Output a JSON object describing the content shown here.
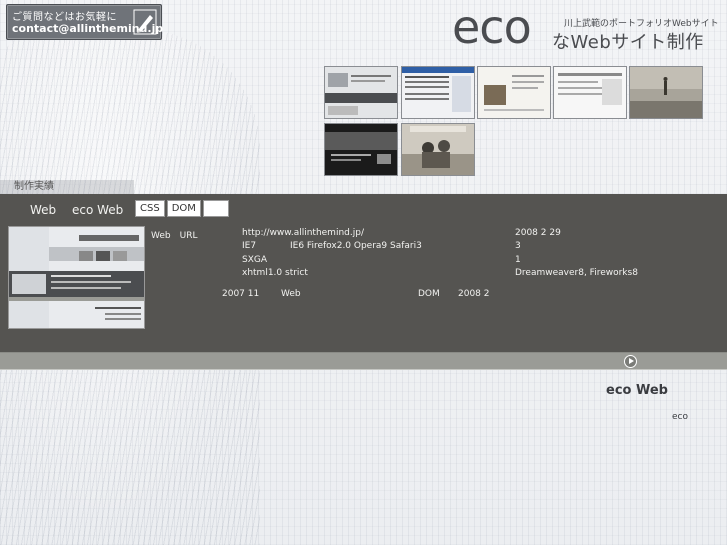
{
  "contact": {
    "line1": "ご質問などはお気軽に",
    "email": "contact@allinthemind.jp"
  },
  "logo": {
    "eco": "eco",
    "subtitle": "川上武範のポートフォリオWebサイト",
    "main": "なWebサイト制作"
  },
  "thumbnails": [
    {
      "name": "thumb-1",
      "palette": [
        "#d6d8da",
        "#4b4d50"
      ]
    },
    {
      "name": "thumb-2",
      "palette": [
        "#f1f2f4",
        "#2f5fa6"
      ]
    },
    {
      "name": "thumb-3",
      "palette": [
        "#f4f3ef",
        "#7a6b56"
      ]
    },
    {
      "name": "thumb-4",
      "palette": [
        "#f7f7f7",
        "#8a8a8a"
      ]
    },
    {
      "name": "thumb-5",
      "palette": [
        "#a8a49a",
        "#5a564e"
      ]
    },
    {
      "name": "thumb-6",
      "palette": [
        "#1b1b1b",
        "#8d8d8d"
      ]
    },
    {
      "name": "thumb-7",
      "palette": [
        "#cfcac0",
        "#3d3a35"
      ]
    }
  ],
  "section_label": "制作実績",
  "project": {
    "title_a": "Web",
    "title_b": "eco Web",
    "tags": [
      "CSS",
      "DOM",
      ""
    ],
    "rows": {
      "label_web_url": "Web　URL",
      "url": "http://www.allinthemind.jp/",
      "browser_ie7": "IE7",
      "browsers": "IE6 Firefox2.0 Opera9 Safari3",
      "resolution": "SXGA",
      "doctype": "xhtml1.0 strict",
      "date_right": "2008 2 29",
      "num_3": "3",
      "num_1": "1",
      "tools": "Dreamweaver8, Fireworks8",
      "history_1": "2007 11",
      "history_web": "Web",
      "history_dom": "DOM",
      "history_2": "2008 2"
    }
  },
  "scroll": {
    "progress": 0.0
  },
  "footer": {
    "heading": "eco  Web",
    "small": "eco"
  },
  "colors": {
    "panel": "#555451",
    "scrollbar": "#9a9b96",
    "accent_text": "#3a3c40"
  }
}
